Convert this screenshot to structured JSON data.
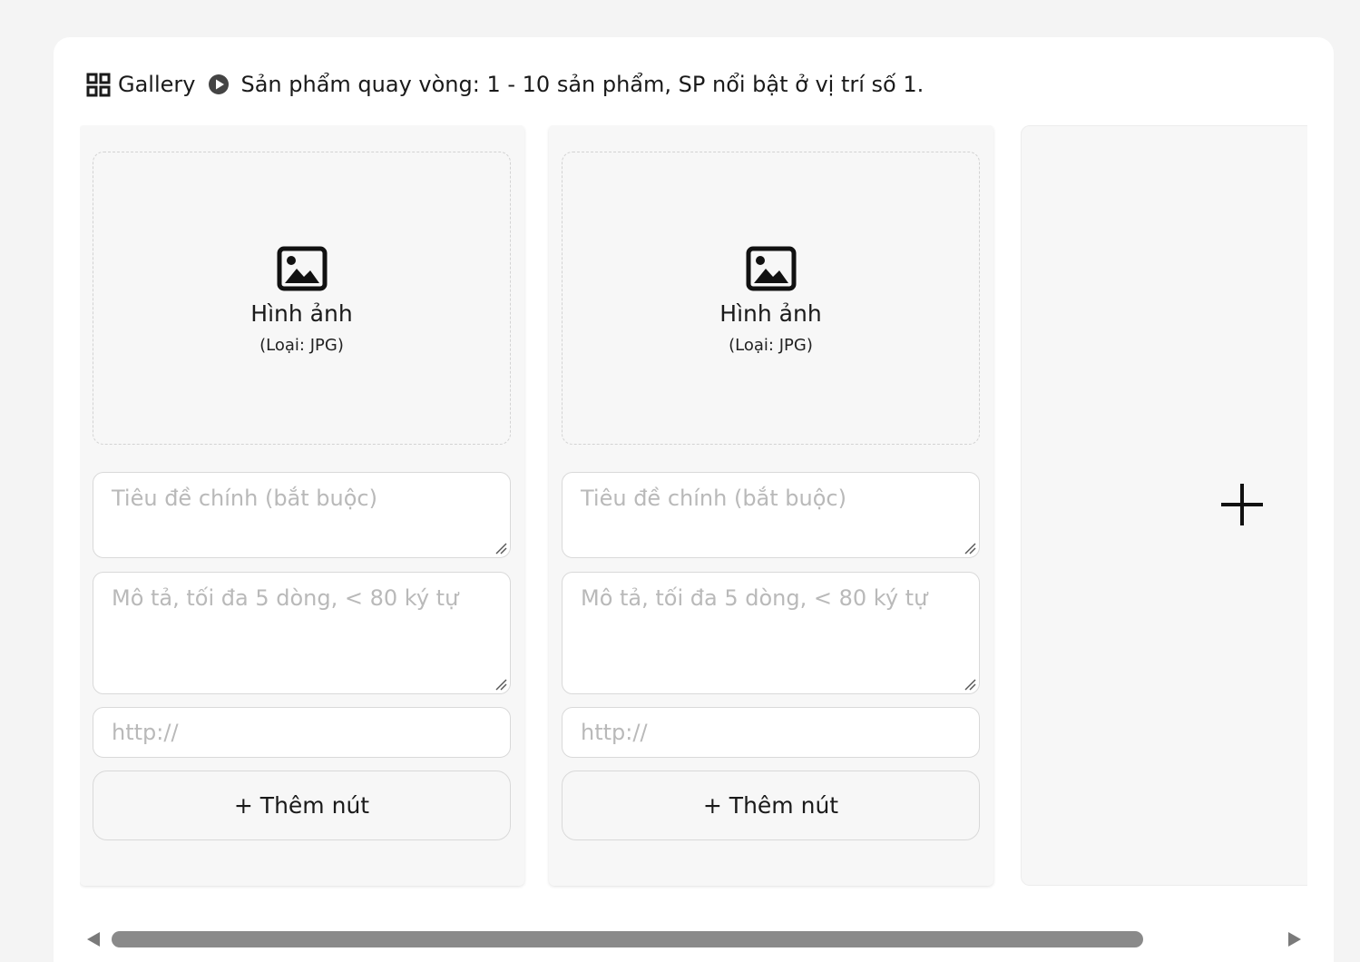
{
  "header": {
    "gallery_label": "Gallery",
    "description": "Sản phẩm quay vòng: 1 - 10 sản phẩm, SP nổi bật ở vị trí số 1."
  },
  "cards": [
    {
      "image_label": "Hình ảnh",
      "image_type": "(Loại: JPG)",
      "title_placeholder": "Tiêu đề chính (bắt buộc)",
      "description_placeholder": "Mô tả, tối đa 5 dòng, < 80 ký tự",
      "url_placeholder": "http://",
      "add_button_label": "+ Thêm nút"
    },
    {
      "image_label": "Hình ảnh",
      "image_type": "(Loại: JPG)",
      "title_placeholder": "Tiêu đề chính (bắt buộc)",
      "description_placeholder": "Mô tả, tối đa 5 dòng, < 80 ký tự",
      "url_placeholder": "http://",
      "add_button_label": "+ Thêm nút"
    }
  ],
  "icons": {
    "gallery": "grid-icon",
    "play": "play-circle-icon",
    "image": "image-icon",
    "add_card": "plus-icon",
    "scroll_left": "triangle-left-icon",
    "scroll_right": "triangle-right-icon"
  },
  "colors": {
    "page_background": "#f4f4f4",
    "panel_background": "#ffffff",
    "card_background": "#f7f7f7",
    "placeholder_text": "#b9b9b9",
    "scroll_thumb": "#8a8a8a"
  },
  "scroll": {
    "position_fraction": 0.0,
    "visible_fraction": 0.86
  }
}
